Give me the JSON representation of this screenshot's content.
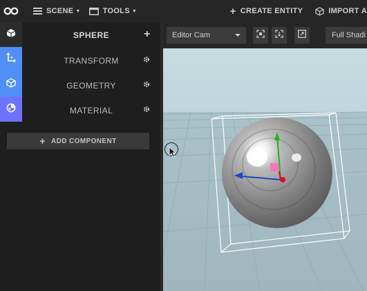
{
  "topbar": {
    "scene_label": "SCENE",
    "tools_label": "TOOLS",
    "create_entity_label": "CREATE ENTITY",
    "import_label": "IMPORT A"
  },
  "inspector": {
    "entity_name": "SPHERE",
    "components": [
      {
        "label": "TRANSFORM"
      },
      {
        "label": "GEOMETRY"
      },
      {
        "label": "MATERIAL"
      }
    ],
    "add_component_label": "ADD COMPONENT"
  },
  "viewport": {
    "camera_select": "Editor Cam",
    "shading_select": "Full Shadi"
  },
  "colors": {
    "accent_blue": "#4f8ff7",
    "accent_indigo": "#6e73ff",
    "gizmo_x": "#1f44c9",
    "gizmo_y": "#21b421",
    "gizmo_z": "#d1102c"
  }
}
